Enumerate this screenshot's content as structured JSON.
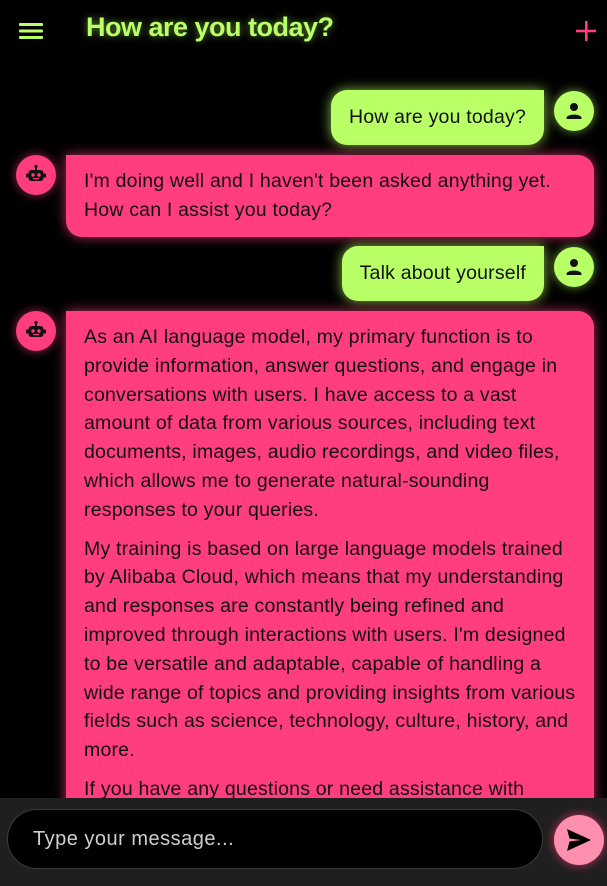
{
  "header": {
    "title": "How are you today?",
    "menu_icon": "hamburger-menu-icon",
    "add_icon": "plus-icon"
  },
  "colors": {
    "user_accent": "#b9ff66",
    "bot_accent": "#ff3d7f",
    "background": "#000000",
    "input_bar": "#1f1f1f"
  },
  "messages": [
    {
      "role": "user",
      "icon": "person-icon",
      "paragraphs": [
        "How are you today?"
      ]
    },
    {
      "role": "bot",
      "icon": "robot-icon",
      "paragraphs": [
        "I'm doing well and I haven't been asked anything yet. How can I assist you today?"
      ]
    },
    {
      "role": "user",
      "icon": "person-icon",
      "paragraphs": [
        "Talk about yourself"
      ]
    },
    {
      "role": "bot",
      "icon": "robot-icon",
      "paragraphs": [
        "As an AI language model, my primary function is to provide information, answer questions, and engage in conversations with users. I have access to a vast amount of data from various sources, including text documents, images, audio recordings, and video files, which allows me to generate natural-sounding responses to your queries.",
        "My training is based on large language models trained by Alibaba Cloud, which means that my understanding and responses are constantly being refined and improved through interactions with users. I'm designed to be versatile and adaptable, capable of handling a wide range of topics and providing insights from various fields such as science, technology, culture, history, and more.",
        "If you have any questions or need assistance with"
      ]
    }
  ],
  "composer": {
    "placeholder": "Type your message...",
    "send_icon": "send-icon"
  }
}
